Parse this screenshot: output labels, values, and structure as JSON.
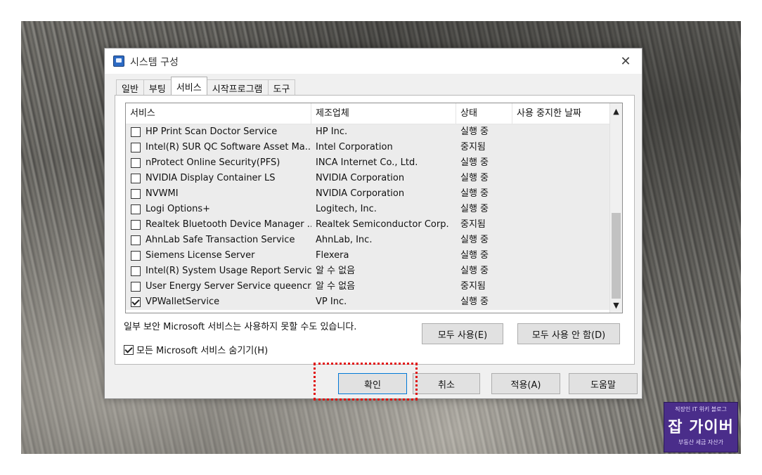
{
  "window": {
    "title": "시스템 구성",
    "close": "✕"
  },
  "tabs": [
    {
      "label": "일반"
    },
    {
      "label": "부팅"
    },
    {
      "label": "서비스"
    },
    {
      "label": "시작프로그램"
    },
    {
      "label": "도구"
    }
  ],
  "columns": {
    "service": "서비스",
    "manufacturer": "제조업체",
    "status": "상태",
    "date_disabled": "사용 중지한 날짜"
  },
  "services": [
    {
      "name": "HP Print Scan Doctor Service",
      "manufacturer": "HP Inc.",
      "status": "실행 중",
      "checked": false
    },
    {
      "name": "Intel(R) SUR QC Software Asset Ma...",
      "manufacturer": "Intel Corporation",
      "status": "중지됨",
      "checked": false
    },
    {
      "name": "nProtect Online Security(PFS)",
      "manufacturer": "INCA Internet Co., Ltd.",
      "status": "실행 중",
      "checked": false
    },
    {
      "name": "NVIDIA Display Container LS",
      "manufacturer": "NVIDIA Corporation",
      "status": "실행 중",
      "checked": false
    },
    {
      "name": "NVWMI",
      "manufacturer": "NVIDIA Corporation",
      "status": "실행 중",
      "checked": false
    },
    {
      "name": "Logi Options+",
      "manufacturer": "Logitech, Inc.",
      "status": "실행 중",
      "checked": false
    },
    {
      "name": "Realtek Bluetooth Device Manager ...",
      "manufacturer": "Realtek Semiconductor Corp.",
      "status": "중지됨",
      "checked": false
    },
    {
      "name": "AhnLab Safe Transaction Service",
      "manufacturer": "AhnLab, Inc.",
      "status": "실행 중",
      "checked": false
    },
    {
      "name": "Siemens License Server",
      "manufacturer": "Flexera",
      "status": "실행 중",
      "checked": false
    },
    {
      "name": "Intel(R) System Usage Report Servic...",
      "manufacturer": "알 수 없음",
      "status": "실행 중",
      "checked": false
    },
    {
      "name": "User Energy Server Service queencr...",
      "manufacturer": "알 수 없음",
      "status": "중지됨",
      "checked": false
    },
    {
      "name": "VPWalletService",
      "manufacturer": "VP Inc.",
      "status": "실행 중",
      "checked": true
    }
  ],
  "scroll": {
    "up": "▲",
    "down": "▼"
  },
  "note": "일부 보안 Microsoft 서비스는 사용하지 못할 수도 있습니다.",
  "hide_ms": {
    "label": "모든 Microsoft 서비스 숨기기(H)",
    "checked": true
  },
  "buttons": {
    "enable_all": "모두 사용(E)",
    "disable_all": "모두 사용 안 함(D)",
    "ok": "확인",
    "cancel": "취소",
    "apply": "적용(A)",
    "help": "도움말"
  },
  "watermark": {
    "top": "직장인 IT 위키 블로그",
    "main": "잡 가이버",
    "bottom": "부동산 세금 자산가"
  },
  "colors": {
    "highlight": "#e01010",
    "dialog_bg": "#f0f0f0",
    "watermark_bg": "#4a2d8a"
  }
}
